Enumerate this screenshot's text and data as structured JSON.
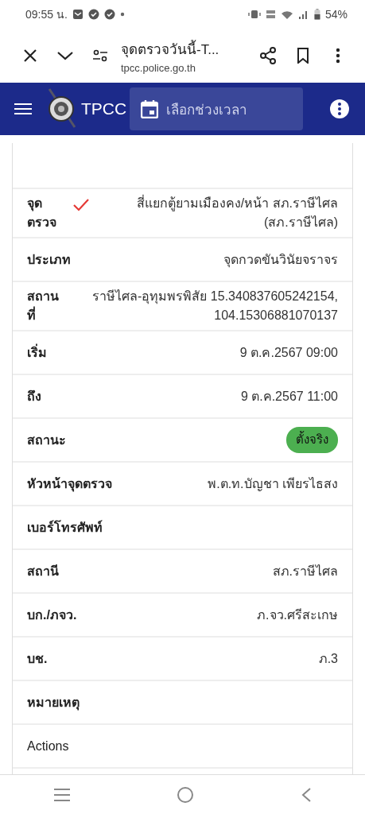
{
  "status_bar": {
    "time": "09:55 น.",
    "battery": "54%"
  },
  "browser": {
    "title": "จุดตรวจวันนี้-T...",
    "url": "tpcc.police.go.th"
  },
  "app_bar": {
    "title": "TPCC",
    "date_picker": {
      "placeholder": "เลือกช่วงเวลา"
    }
  },
  "details": [
    {
      "label": "จุดตรวจ",
      "value": "สี่แยกตู้ยามเมืองคง/หน้า สภ.ราษีไศล (สภ.ราษีไศล)",
      "kind": "checked"
    },
    {
      "label": "ประเภท",
      "value": "จุดกวดขันวินัยจราจร",
      "kind": "text"
    },
    {
      "label": "สถานที่",
      "value": "ราษีไศล-อุทุมพรพิสัย 15.340837605242154, 104.15306881070137",
      "kind": "text"
    },
    {
      "label": "เริ่ม",
      "value": "9 ต.ค.2567 09:00",
      "kind": "text"
    },
    {
      "label": "ถึง",
      "value": "9 ต.ค.2567 11:00",
      "kind": "text"
    },
    {
      "label": "สถานะ",
      "value": "ตั้งจริง",
      "kind": "status",
      "color": "#4caf50"
    },
    {
      "label": "หัวหน้าจุดตรวจ",
      "value": "พ.ต.ท.บัญชา เพียรไธสง",
      "kind": "text"
    },
    {
      "label": "เบอร์โทรศัพท์",
      "kind": "text"
    },
    {
      "label": "สถานี",
      "value": "สภ.ราษีไศล",
      "kind": "text"
    },
    {
      "label": "บก./ภจว.",
      "value": "ภ.จว.ศรีสะเกษ",
      "kind": "text"
    },
    {
      "label": "บช.",
      "value": "ภ.3",
      "kind": "text"
    },
    {
      "label": "หมายเหตุ",
      "kind": "text"
    },
    {
      "label": "Actions",
      "kind": "plain"
    }
  ]
}
